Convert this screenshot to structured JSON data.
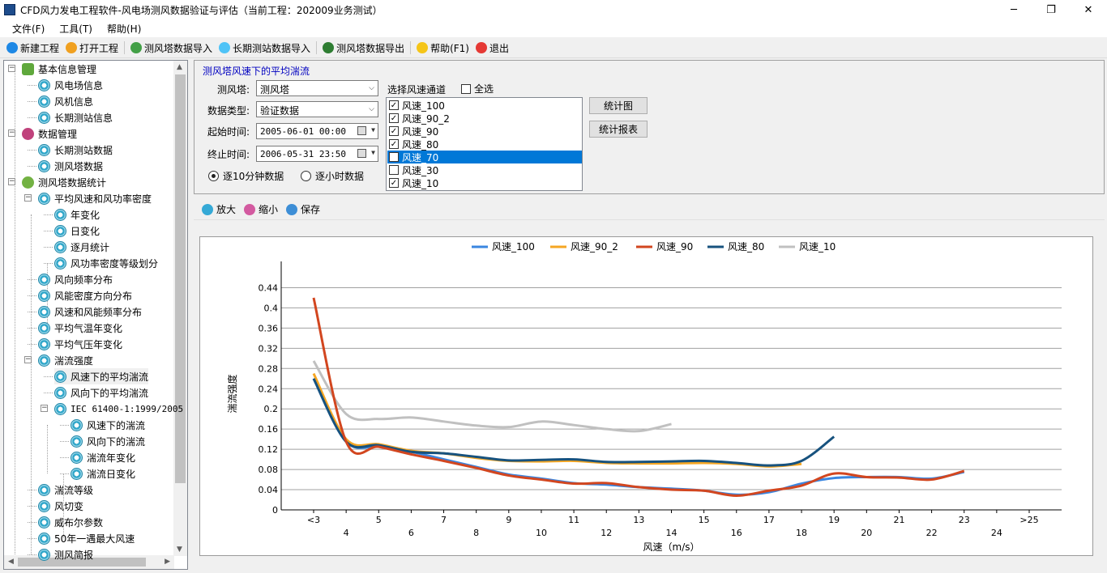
{
  "window": {
    "title": "CFD风力发电工程软件-风电场测风数据验证与评估（当前工程：202009业务测试）",
    "minimize": "─",
    "maximize": "❐",
    "close": "✕"
  },
  "menu": [
    "文件(F)",
    "工具(T)",
    "帮助(H)"
  ],
  "toolbar": [
    {
      "label": "新建工程",
      "icon": "new-project-icon",
      "color": "#1e88e5"
    },
    {
      "label": "打开工程",
      "icon": "open-project-icon",
      "color": "#f0a020"
    },
    {
      "label": "测风塔数据导入",
      "icon": "tower-import-icon",
      "color": "#43a047"
    },
    {
      "label": "长期测站数据导入",
      "icon": "station-import-icon",
      "color": "#4fc3f7"
    },
    {
      "label": "测风塔数据导出",
      "icon": "tower-export-icon",
      "color": "#2e7d32"
    },
    {
      "label": "帮助(F1)",
      "icon": "help-icon",
      "color": "#f5c518"
    },
    {
      "label": "退出",
      "icon": "exit-icon",
      "color": "#e53935"
    }
  ],
  "tree": [
    {
      "label": "基本信息管理",
      "level": 0,
      "expander": "−",
      "icon": "root1"
    },
    {
      "label": "风电场信息",
      "level": 1,
      "icon": "leaf"
    },
    {
      "label": "风机信息",
      "level": 1,
      "icon": "leaf"
    },
    {
      "label": "长期测站信息",
      "level": 1,
      "icon": "leaf"
    },
    {
      "label": "数据管理",
      "level": 0,
      "expander": "−",
      "icon": "root2"
    },
    {
      "label": "长期测站数据",
      "level": 1,
      "icon": "leaf"
    },
    {
      "label": "测风塔数据",
      "level": 1,
      "icon": "leaf"
    },
    {
      "label": "测风塔数据统计",
      "level": 0,
      "expander": "−",
      "icon": "root3"
    },
    {
      "label": "平均风速和风功率密度",
      "level": 1,
      "expander": "−",
      "icon": "leaf"
    },
    {
      "label": "年变化",
      "level": 2,
      "icon": "leaf"
    },
    {
      "label": "日变化",
      "level": 2,
      "icon": "leaf"
    },
    {
      "label": "逐月统计",
      "level": 2,
      "icon": "leaf"
    },
    {
      "label": "风功率密度等级划分",
      "level": 2,
      "icon": "leaf"
    },
    {
      "label": "风向频率分布",
      "level": 1,
      "icon": "leaf"
    },
    {
      "label": "风能密度方向分布",
      "level": 1,
      "icon": "leaf"
    },
    {
      "label": "风速和风能频率分布",
      "level": 1,
      "icon": "leaf"
    },
    {
      "label": "平均气温年变化",
      "level": 1,
      "icon": "leaf"
    },
    {
      "label": "平均气压年变化",
      "level": 1,
      "icon": "leaf"
    },
    {
      "label": "湍流强度",
      "level": 1,
      "expander": "−",
      "icon": "leaf"
    },
    {
      "label": "风速下的平均湍流",
      "level": 2,
      "icon": "leaf",
      "selected": true
    },
    {
      "label": "风向下的平均湍流",
      "level": 2,
      "icon": "leaf"
    },
    {
      "label": "IEC 61400-1:1999/2005",
      "level": 2,
      "expander": "−",
      "icon": "leaf",
      "mono": true
    },
    {
      "label": "风速下的湍流",
      "level": 3,
      "icon": "leaf"
    },
    {
      "label": "风向下的湍流",
      "level": 3,
      "icon": "leaf"
    },
    {
      "label": "湍流年变化",
      "level": 3,
      "icon": "leaf"
    },
    {
      "label": "湍流日变化",
      "level": 3,
      "icon": "leaf"
    },
    {
      "label": "湍流等级",
      "level": 1,
      "icon": "leaf"
    },
    {
      "label": "风切变",
      "level": 1,
      "icon": "leaf"
    },
    {
      "label": "威布尔参数",
      "level": 1,
      "icon": "leaf"
    },
    {
      "label": "50年一遇最大风速",
      "level": 1,
      "icon": "leaf"
    },
    {
      "label": "测风简报",
      "level": 1,
      "icon": "leaf"
    }
  ],
  "query": {
    "group_title": "测风塔风速下的平均湍流",
    "tower_label": "测风塔:",
    "tower_value": "测风塔",
    "datatype_label": "数据类型:",
    "datatype_value": "验证数据",
    "start_label": "起始时间:",
    "start_value": "2005-06-01 00:00",
    "end_label": "终止时间:",
    "end_value": "2006-05-31 23:50",
    "radio_10min": "逐10分钟数据",
    "radio_hour": "逐小时数据",
    "channel_label": "选择风速通道",
    "select_all": "全选",
    "channels": [
      {
        "label": "风速_100",
        "checked": true
      },
      {
        "label": "风速_90_2",
        "checked": true
      },
      {
        "label": "风速_90",
        "checked": true
      },
      {
        "label": "风速_80",
        "checked": true
      },
      {
        "label": "风速_70",
        "checked": false,
        "selected": true
      },
      {
        "label": "风速_30",
        "checked": false
      },
      {
        "label": "风速_10",
        "checked": true
      }
    ],
    "btn_chart": "统计图",
    "btn_report": "统计报表"
  },
  "chart_toolbar": {
    "zoom_in": "放大",
    "zoom_out": "缩小",
    "save": "保存"
  },
  "chart_data": {
    "type": "line",
    "xlabel": "风速（m/s）",
    "ylabel": "湍流强度",
    "ylim": [
      0,
      0.46
    ],
    "y_ticks": [
      "0",
      "0.04",
      "0.08",
      "0.12",
      "0.16",
      "0.2",
      "0.24",
      "0.28",
      "0.32",
      "0.36",
      "0.4",
      "0.44"
    ],
    "categories": [
      "<3",
      "4",
      "5",
      "6",
      "7",
      "8",
      "9",
      "10",
      "11",
      "12",
      "13",
      "14",
      "15",
      "16",
      "17",
      "18",
      "19",
      "20",
      "21",
      "22",
      "23",
      "24",
      ">25"
    ],
    "legend_position": "top",
    "grid": "horizontal",
    "series": [
      {
        "name": "风速_100",
        "color": "#3a86e0",
        "values": [
          0.26,
          0.135,
          0.125,
          0.115,
          0.1,
          0.085,
          0.07,
          0.062,
          0.053,
          0.05,
          0.045,
          0.042,
          0.038,
          0.03,
          0.035,
          0.052,
          0.063,
          0.065,
          0.065,
          0.062,
          0.075,
          null,
          null
        ]
      },
      {
        "name": "风速_90_2",
        "color": "#f5a623",
        "values": [
          0.27,
          0.14,
          0.13,
          0.117,
          0.112,
          0.103,
          0.097,
          0.096,
          0.097,
          0.093,
          0.092,
          0.092,
          0.093,
          0.091,
          0.086,
          0.091,
          null,
          null,
          null,
          null,
          null,
          null,
          null
        ]
      },
      {
        "name": "风速_90",
        "color": "#d2461f",
        "values": [
          0.42,
          0.135,
          0.125,
          0.11,
          0.097,
          0.083,
          0.068,
          0.06,
          0.052,
          0.053,
          0.045,
          0.04,
          0.038,
          0.028,
          0.038,
          0.048,
          0.072,
          0.065,
          0.064,
          0.06,
          0.077,
          null,
          null
        ]
      },
      {
        "name": "风速_80",
        "color": "#17527e",
        "values": [
          0.26,
          0.135,
          0.128,
          0.115,
          0.112,
          0.105,
          0.098,
          0.099,
          0.1,
          0.095,
          0.095,
          0.096,
          0.097,
          0.093,
          0.088,
          0.097,
          0.145,
          null,
          null,
          null,
          null,
          null,
          null
        ]
      },
      {
        "name": "风速_10",
        "color": "#c0c0c0",
        "values": [
          0.295,
          0.19,
          0.18,
          0.183,
          0.175,
          0.167,
          0.164,
          0.175,
          0.168,
          0.16,
          0.156,
          0.17,
          null,
          null,
          null,
          null,
          null,
          null,
          null,
          null,
          null,
          null,
          null
        ]
      }
    ]
  }
}
